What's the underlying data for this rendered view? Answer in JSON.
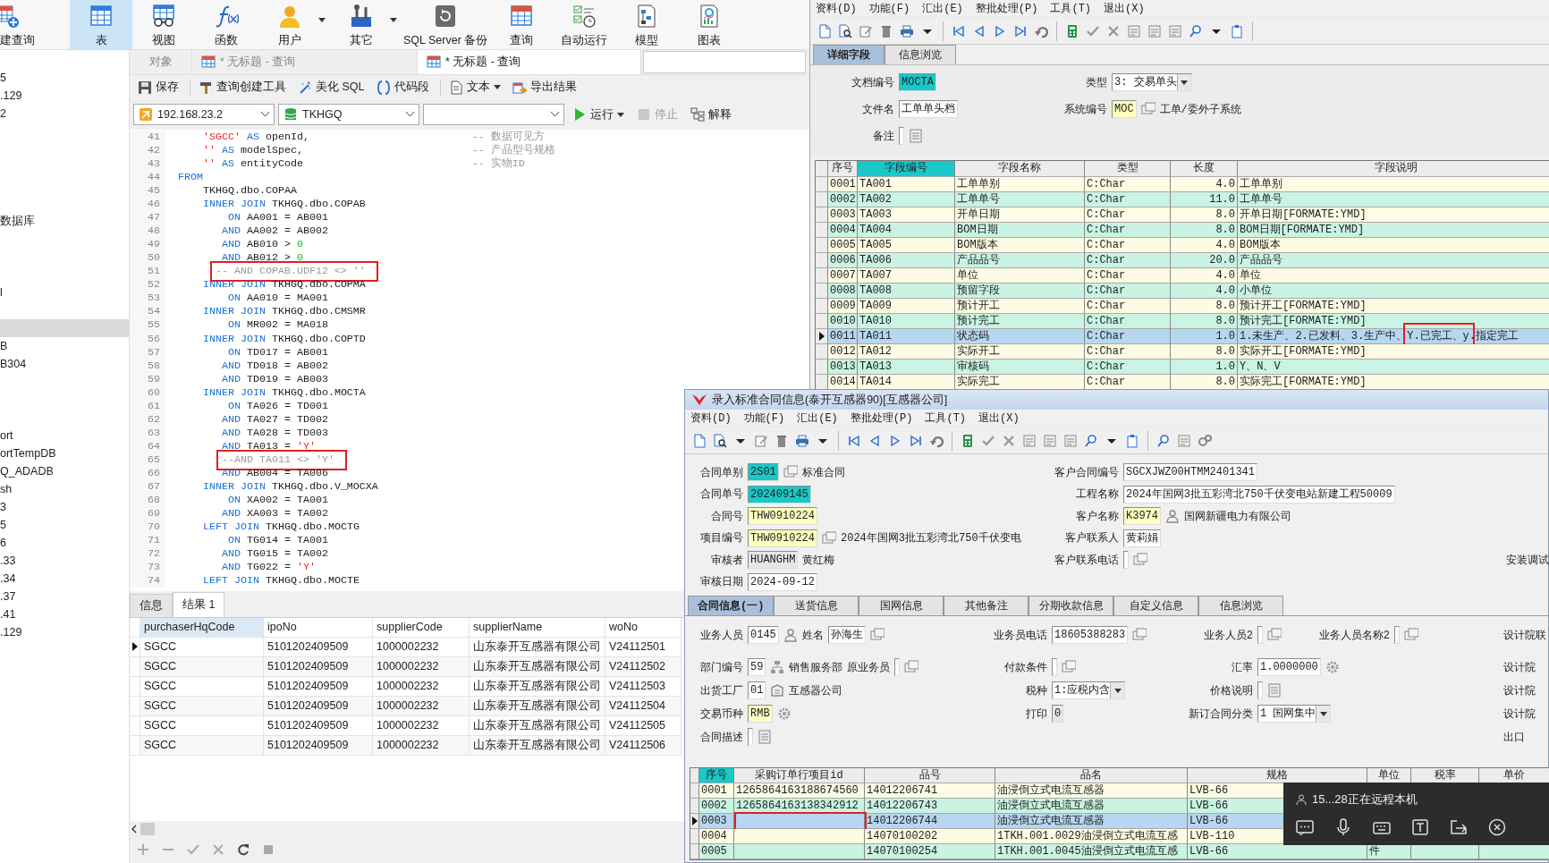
{
  "navicat": {
    "toolbar": [
      {
        "label": "建查询",
        "selected": false,
        "dropdown": false
      },
      {
        "label": "表",
        "selected": true,
        "dropdown": false
      },
      {
        "label": "视图",
        "selected": false,
        "dropdown": false
      },
      {
        "label": "函数",
        "selected": false,
        "dropdown": false
      },
      {
        "label": "用户",
        "selected": false,
        "dropdown": true
      },
      {
        "label": "其它",
        "selected": false,
        "dropdown": true
      },
      {
        "label": "SQL Server 备份",
        "selected": false,
        "dropdown": false
      },
      {
        "label": "查询",
        "selected": false,
        "dropdown": false
      },
      {
        "label": "自动运行",
        "selected": false,
        "dropdown": false
      },
      {
        "label": "模型",
        "selected": false,
        "dropdown": false
      },
      {
        "label": "图表",
        "selected": false,
        "dropdown": false
      }
    ],
    "sidebar": [
      {
        "kind": "item",
        "label": "5",
        "selected": false
      },
      {
        "kind": "item",
        "label": ".129",
        "selected": false
      },
      {
        "kind": "item",
        "label": "2",
        "selected": false
      },
      {
        "kind": "hidden",
        "selected": false
      },
      {
        "kind": "hidden",
        "selected": false
      },
      {
        "kind": "hidden",
        "selected": false
      },
      {
        "kind": "hidden",
        "selected": false
      },
      {
        "kind": "hidden",
        "selected": false
      },
      {
        "kind": "item",
        "label": "数据库",
        "selected": false
      },
      {
        "kind": "hidden",
        "selected": false
      },
      {
        "kind": "hidden",
        "selected": false
      },
      {
        "kind": "hidden",
        "selected": false
      },
      {
        "kind": "item",
        "label": "l",
        "selected": false
      },
      {
        "kind": "hidden",
        "selected": false
      },
      {
        "kind": "hidden",
        "selected": true
      },
      {
        "kind": "item",
        "label": "B",
        "selected": false
      },
      {
        "kind": "item",
        "label": "B304",
        "selected": false
      },
      {
        "kind": "hidden",
        "selected": false
      },
      {
        "kind": "hidden",
        "selected": false
      },
      {
        "kind": "hidden",
        "selected": false
      },
      {
        "kind": "item",
        "label": "ort",
        "selected": false
      },
      {
        "kind": "item",
        "label": "ortTempDB",
        "selected": false
      },
      {
        "kind": "item",
        "label": "Q_ADADB",
        "selected": false
      },
      {
        "kind": "item",
        "label": "sh",
        "selected": false
      },
      {
        "kind": "item",
        "label": "3",
        "selected": false
      },
      {
        "kind": "item",
        "label": "5",
        "selected": false
      },
      {
        "kind": "item",
        "label": "6",
        "selected": false
      },
      {
        "kind": "item",
        "label": ".33",
        "selected": false
      },
      {
        "kind": "item",
        "label": ".34",
        "selected": false
      },
      {
        "kind": "item",
        "label": ".37",
        "selected": false
      },
      {
        "kind": "item",
        "label": ".41",
        "selected": false
      },
      {
        "kind": "item",
        "label": ".129",
        "selected": false
      }
    ],
    "editor_tabs": [
      {
        "label": "对象",
        "selected": false
      },
      {
        "label": "* 无标题 - 查询",
        "selected": false
      },
      {
        "label": "* 无标题 - 查询",
        "selected": true
      }
    ],
    "actions": [
      {
        "label": "保存",
        "dropdown": false
      },
      {
        "label": "查询创建工具",
        "dropdown": false
      },
      {
        "label": "美化 SQL",
        "dropdown": false
      },
      {
        "label": "代码段",
        "dropdown": false
      },
      {
        "label": "文本",
        "dropdown": true
      },
      {
        "label": "导出结果",
        "dropdown": false
      }
    ],
    "connection": "192.168.23.2",
    "database": "TKHGQ",
    "run_controls": [
      {
        "label": "运行",
        "dropdown": true,
        "disabled": false
      },
      {
        "label": "停止",
        "dropdown": false,
        "disabled": true
      },
      {
        "label": "解释",
        "dropdown": false,
        "disabled": false
      }
    ],
    "editor": {
      "lines": [
        {
          "number": "41",
          "code": [
            {
              "kind": "str",
              "text": "      'SGCC'"
            },
            {
              "kind": "kw",
              "text": " AS"
            },
            {
              "kind": "txt",
              "text": " openId,"
            }
          ],
          "comment": "-- 数据可见方",
          "marked": false
        },
        {
          "number": "42",
          "code": [
            {
              "kind": "str",
              "text": "      ''"
            },
            {
              "kind": "kw",
              "text": " AS"
            },
            {
              "kind": "txt",
              "text": " modelSpec,"
            }
          ],
          "comment": "-- 产品型号规格",
          "marked": false
        },
        {
          "number": "43",
          "code": [
            {
              "kind": "str",
              "text": "      ''"
            },
            {
              "kind": "kw",
              "text": " AS"
            },
            {
              "kind": "txt",
              "text": " entityCode"
            }
          ],
          "comment": "-- 实物ID",
          "marked": false
        },
        {
          "number": "44",
          "code": [
            {
              "kind": "kw",
              "text": "  FROM"
            }
          ],
          "marked": false
        },
        {
          "number": "45",
          "code": [
            {
              "kind": "txt",
              "text": "      TKHGQ.dbo.COPAA"
            }
          ],
          "marked": false
        },
        {
          "number": "46",
          "code": [
            {
              "kind": "kw",
              "text": "      INNER JOIN"
            },
            {
              "kind": "txt",
              "text": " TKHGQ.dbo.COPAB"
            }
          ],
          "marked": false
        },
        {
          "number": "47",
          "code": [
            {
              "kind": "kw",
              "text": "          ON"
            },
            {
              "kind": "txt",
              "text": " AA001 = AB001"
            }
          ],
          "marked": false
        },
        {
          "number": "48",
          "code": [
            {
              "kind": "kw",
              "text": "         AND"
            },
            {
              "kind": "txt",
              "text": " AA002 = AB002"
            }
          ],
          "marked": false
        },
        {
          "number": "49",
          "code": [
            {
              "kind": "kw",
              "text": "         AND"
            },
            {
              "kind": "txt",
              "text": " AB010 > "
            },
            {
              "kind": "num",
              "text": "0"
            }
          ],
          "marked": false
        },
        {
          "number": "50",
          "code": [
            {
              "kind": "kw",
              "text": "         AND"
            },
            {
              "kind": "txt",
              "text": " AB012 > "
            },
            {
              "kind": "num",
              "text": "0"
            }
          ],
          "marked": false
        },
        {
          "number": "51",
          "code": [
            {
              "kind": "cmt",
              "text": "        -- AND COPAB.UDF12 <> ''"
            }
          ],
          "marked": true
        },
        {
          "number": "52",
          "code": [
            {
              "kind": "kw",
              "text": "      INNER JOIN"
            },
            {
              "kind": "txt",
              "text": " TKHGQ.dbo.COPMA"
            }
          ],
          "marked": false
        },
        {
          "number": "53",
          "code": [
            {
              "kind": "kw",
              "text": "          ON"
            },
            {
              "kind": "txt",
              "text": " AA010 = MA001"
            }
          ],
          "marked": false
        },
        {
          "number": "54",
          "code": [
            {
              "kind": "kw",
              "text": "      INNER JOIN"
            },
            {
              "kind": "txt",
              "text": " TKHGQ.dbo.CMSMR"
            }
          ],
          "marked": false
        },
        {
          "number": "55",
          "code": [
            {
              "kind": "kw",
              "text": "          ON"
            },
            {
              "kind": "txt",
              "text": " MR002 = MA018"
            }
          ],
          "marked": false
        },
        {
          "number": "56",
          "code": [
            {
              "kind": "kw",
              "text": "      INNER JOIN"
            },
            {
              "kind": "txt",
              "text": " TKHGQ.dbo.COPTD"
            }
          ],
          "marked": false
        },
        {
          "number": "57",
          "code": [
            {
              "kind": "kw",
              "text": "          ON"
            },
            {
              "kind": "txt",
              "text": " TD017 = AB001"
            }
          ],
          "marked": false
        },
        {
          "number": "58",
          "code": [
            {
              "kind": "kw",
              "text": "         AND"
            },
            {
              "kind": "txt",
              "text": " TD018 = AB002"
            }
          ],
          "marked": false
        },
        {
          "number": "59",
          "code": [
            {
              "kind": "kw",
              "text": "         AND"
            },
            {
              "kind": "txt",
              "text": " TD019 = AB003"
            }
          ],
          "marked": false
        },
        {
          "number": "60",
          "code": [
            {
              "kind": "kw",
              "text": "      INNER JOIN"
            },
            {
              "kind": "txt",
              "text": " TKHGQ.dbo.MOCTA"
            }
          ],
          "marked": false
        },
        {
          "number": "61",
          "code": [
            {
              "kind": "kw",
              "text": "          ON"
            },
            {
              "kind": "txt",
              "text": " TA026 = TD001"
            }
          ],
          "marked": false
        },
        {
          "number": "62",
          "code": [
            {
              "kind": "kw",
              "text": "         AND"
            },
            {
              "kind": "txt",
              "text": " TA027 = TD002"
            }
          ],
          "marked": false
        },
        {
          "number": "63",
          "code": [
            {
              "kind": "kw",
              "text": "         AND"
            },
            {
              "kind": "txt",
              "text": " TA028 = TD003"
            }
          ],
          "marked": false
        },
        {
          "number": "64",
          "code": [
            {
              "kind": "kw",
              "text": "         AND"
            },
            {
              "kind": "txt",
              "text": " TA013 = "
            },
            {
              "kind": "str",
              "text": "'Y'"
            }
          ],
          "marked": false
        },
        {
          "number": "65",
          "code": [
            {
              "kind": "cmt",
              "text": "         --AND TA011 <> 'Y'"
            }
          ],
          "marked": true
        },
        {
          "number": "66",
          "code": [
            {
              "kind": "kw",
              "text": "         AND"
            },
            {
              "kind": "txt",
              "text": " AB004 = TA006"
            }
          ],
          "marked": false
        },
        {
          "number": "67",
          "code": [
            {
              "kind": "kw",
              "text": "      INNER JOIN"
            },
            {
              "kind": "txt",
              "text": " TKHGQ.dbo.V_MOCXA"
            }
          ],
          "marked": false
        },
        {
          "number": "68",
          "code": [
            {
              "kind": "kw",
              "text": "          ON"
            },
            {
              "kind": "txt",
              "text": " XA002 = TA001"
            }
          ],
          "marked": false
        },
        {
          "number": "69",
          "code": [
            {
              "kind": "kw",
              "text": "         AND"
            },
            {
              "kind": "txt",
              "text": " XA003 = TA002"
            }
          ],
          "marked": false
        },
        {
          "number": "70",
          "code": [
            {
              "kind": "kw",
              "text": "      LEFT JOIN"
            },
            {
              "kind": "txt",
              "text": " TKHGQ.dbo.MOCTG"
            }
          ],
          "marked": false
        },
        {
          "number": "71",
          "code": [
            {
              "kind": "kw",
              "text": "          ON"
            },
            {
              "kind": "txt",
              "text": " TG014 = TA001"
            }
          ],
          "marked": false
        },
        {
          "number": "72",
          "code": [
            {
              "kind": "kw",
              "text": "         AND"
            },
            {
              "kind": "txt",
              "text": " TG015 = TA002"
            }
          ],
          "marked": false
        },
        {
          "number": "73",
          "code": [
            {
              "kind": "kw",
              "text": "         AND"
            },
            {
              "kind": "txt",
              "text": " TG022 = "
            },
            {
              "kind": "str",
              "text": "'Y'"
            }
          ],
          "marked": false
        },
        {
          "number": "74",
          "code": [
            {
              "kind": "kw",
              "text": "      LEFT JOIN"
            },
            {
              "kind": "txt",
              "text": " TKHGQ.dbo.MOCTE"
            }
          ],
          "marked": false
        }
      ]
    },
    "result_tabs": [
      {
        "label": "信息",
        "selected": false
      },
      {
        "label": "结果 1",
        "selected": true
      }
    ],
    "result": {
      "columns": [
        {
          "label": "purchaserHqCode",
          "selected": true
        },
        {
          "label": "ipoNo",
          "selected": false
        },
        {
          "label": "supplierCode",
          "selected": false
        },
        {
          "label": "supplierName",
          "selected": false
        },
        {
          "label": "woNo",
          "selected": false
        }
      ],
      "rows": [
        {
          "current": true,
          "cells": [
            "SGCC",
            "5101202409509",
            "1000002232",
            "山东泰开互感器有限公司",
            "V24112501"
          ]
        },
        {
          "current": false,
          "cells": [
            "SGCC",
            "5101202409509",
            "1000002232",
            "山东泰开互感器有限公司",
            "V24112502"
          ]
        },
        {
          "current": false,
          "cells": [
            "SGCC",
            "5101202409509",
            "1000002232",
            "山东泰开互感器有限公司",
            "V24112503"
          ]
        },
        {
          "current": false,
          "cells": [
            "SGCC",
            "5101202409509",
            "1000002232",
            "山东泰开互感器有限公司",
            "V24112504"
          ]
        },
        {
          "current": false,
          "cells": [
            "SGCC",
            "5101202409509",
            "1000002232",
            "山东泰开互感器有限公司",
            "V24112505"
          ]
        },
        {
          "current": false,
          "cells": [
            "SGCC",
            "5101202409509",
            "1000002232",
            "山东泰开互感器有限公司",
            "V24112506"
          ]
        }
      ]
    }
  },
  "field_window": {
    "menu": [
      "资料(D)",
      "功能(F)",
      "汇出(E)",
      "整批处理(P)",
      "工具(T)",
      "退出(X)"
    ],
    "tabs": [
      {
        "label": "详细字段",
        "selected": true
      },
      {
        "label": "信息浏览",
        "selected": false
      }
    ],
    "form": [
      [
        {
          "label": "文档编号",
          "value": "MOCTA",
          "kind": "key"
        },
        {
          "label": "类型",
          "value": "3: 交易单头",
          "kind": "select"
        }
      ],
      [
        {
          "label": "文件名",
          "value": "工单单头档",
          "kind": "plain",
          "lookup": false
        },
        {
          "label": "系统编号",
          "value": "MOC",
          "kind": "required",
          "lookup": true,
          "note": "工单/委外子系统"
        }
      ],
      [
        {
          "label": "备注",
          "kind": "plain",
          "lookup": true
        }
      ]
    ],
    "grid": {
      "columns": [
        {
          "label": "序号",
          "selected": false
        },
        {
          "label": "字段编号",
          "selected": true
        },
        {
          "label": "字段名称",
          "selected": false
        },
        {
          "label": "类型",
          "selected": false
        },
        {
          "label": "长度",
          "selected": false
        },
        {
          "label": "字段说明",
          "selected": false
        }
      ],
      "rows": [
        {
          "selected": false,
          "marked": false,
          "cells": [
            "0001",
            "TA001",
            "工单单别",
            "C:Char",
            "4.0",
            "工单单别"
          ]
        },
        {
          "selected": false,
          "marked": false,
          "cells": [
            "0002",
            "TA002",
            "工单单号",
            "C:Char",
            "11.0",
            "工单单号"
          ]
        },
        {
          "selected": false,
          "marked": false,
          "cells": [
            "0003",
            "TA003",
            "开单日期",
            "C:Char",
            "8.0",
            "开单日期[FORMATE:YMD]"
          ]
        },
        {
          "selected": false,
          "marked": false,
          "cells": [
            "0004",
            "TA004",
            "BOM日期",
            "C:Char",
            "8.0",
            "BOM日期[FORMATE:YMD]"
          ]
        },
        {
          "selected": false,
          "marked": false,
          "cells": [
            "0005",
            "TA005",
            "BOM版本",
            "C:Char",
            "4.0",
            "BOM版本"
          ]
        },
        {
          "selected": false,
          "marked": false,
          "cells": [
            "0006",
            "TA006",
            "产品品号",
            "C:Char",
            "20.0",
            "产品品号"
          ]
        },
        {
          "selected": false,
          "marked": false,
          "cells": [
            "0007",
            "TA007",
            "单位",
            "C:Char",
            "4.0",
            "单位"
          ]
        },
        {
          "selected": false,
          "marked": false,
          "cells": [
            "0008",
            "TA008",
            "预留字段",
            "C:Char",
            "4.0",
            "小单位"
          ]
        },
        {
          "selected": false,
          "marked": false,
          "cells": [
            "0009",
            "TA009",
            "预计开工",
            "C:Char",
            "8.0",
            "预计开工[FORMATE:YMD]"
          ]
        },
        {
          "selected": false,
          "marked": false,
          "cells": [
            "0010",
            "TA010",
            "预计完工",
            "C:Char",
            "8.0",
            "预计完工[FORMATE:YMD]"
          ]
        },
        {
          "selected": true,
          "marked": true,
          "cells": [
            "0011",
            "TA011",
            "状态码",
            "C:Char",
            "1.0",
            "1.未生产、2.已发料、3.生产中、Y.已完工、y.指定完工"
          ]
        },
        {
          "selected": false,
          "marked": false,
          "cells": [
            "0012",
            "TA012",
            "实际开工",
            "C:Char",
            "8.0",
            "实际开工[FORMATE:YMD]"
          ]
        },
        {
          "selected": false,
          "marked": false,
          "cells": [
            "0013",
            "TA013",
            "审核码",
            "C:Char",
            "1.0",
            "Y、N、V"
          ]
        },
        {
          "selected": false,
          "marked": false,
          "cells": [
            "0014",
            "TA014",
            "实际完工",
            "C:Char",
            "8.0",
            "实际完工[FORMATE:YMD]"
          ]
        }
      ]
    }
  },
  "contract_window": {
    "title": "录入标准合同信息(泰开互感器90)[互感器公司]",
    "menu": [
      "资料(D)",
      "功能(F)",
      "汇出(E)",
      "整批处理(P)",
      "工具(T)",
      "退出(X)"
    ],
    "header": [
      {
        "left": {
          "label": "合同单别",
          "value": "2S01",
          "kind": "key",
          "lookup": true,
          "note": "标准合同"
        },
        "right": {
          "label": "客户合同编号",
          "value": "SGCXJWZ00HTMM2401341",
          "kind": "plain",
          "lookup": false
        }
      },
      {
        "left": {
          "label": "合同单号",
          "value": "202409145",
          "kind": "key",
          "lookup": false
        },
        "right": {
          "label": "工程名称",
          "value": "2024年国网3批五彩湾北750千伏变电站新建工程50009",
          "kind": "plain",
          "lookup": false
        }
      },
      {
        "left": {
          "label": "合同号",
          "value": "THW0910224",
          "kind": "required",
          "lookup": false
        },
        "right": {
          "label": "客户名称",
          "value": "K3974",
          "kind": "required",
          "lookup": true,
          "note": "国网新疆电力有限公司"
        }
      },
      {
        "left": {
          "label": "项目编号",
          "value": "THW0910224",
          "kind": "required",
          "lookup": true,
          "note": "2024年国网3批五彩湾北750千伏变电"
        },
        "right": {
          "label": "客户联系人",
          "value": "黄莉娟",
          "kind": "plain",
          "lookup": false
        }
      },
      {
        "left": {
          "label": "审核者",
          "value": "HUANGHM",
          "kind": "readonly",
          "lookup": false,
          "note": "黄红梅"
        },
        "right": {
          "label": "客户联系电话",
          "kind": "plain",
          "lookup": true
        },
        "edge": {
          "label": "安装调试"
        }
      },
      {
        "left": {
          "label": "审核日期",
          "value": "2024-09-12",
          "kind": "plain",
          "lookup": false
        }
      }
    ],
    "tabs": [
      {
        "label": "合同信息(一)",
        "selected": true
      },
      {
        "label": "送货信息",
        "selected": false
      },
      {
        "label": "国网信息",
        "selected": false
      },
      {
        "label": "其他备注",
        "selected": false
      },
      {
        "label": "分期收款信息",
        "selected": false
      },
      {
        "label": "自定义信息",
        "selected": false
      },
      {
        "label": "信息浏览",
        "selected": false
      }
    ],
    "detail": [
      {
        "column_1": {
          "label": "业务人员",
          "value": "0145",
          "kind": "plain",
          "lookup": true
        },
        "column_1b": {
          "label": "姓名",
          "value": "孙海生",
          "kind": "plain",
          "lookup": true
        },
        "column_2": {
          "label": "业务员电话",
          "value": "18605388283",
          "kind": "plain",
          "lookup": true
        },
        "column_3": {
          "label": "业务人员2",
          "kind": "plain",
          "lookup": true
        },
        "column_4": {
          "label": "业务人员名称2",
          "kind": "plain",
          "lookup": true
        },
        "edge": {
          "label": "设计院联"
        }
      },
      {
        "column_1": {
          "label": "部门编号",
          "value": "59",
          "kind": "plain",
          "lookup": true,
          "note": "销售服务部"
        },
        "column_1b": {
          "label": "原业务员",
          "kind": "plain",
          "lookup": true
        },
        "column_2": {
          "label": "付款条件",
          "kind": "plain",
          "lookup": true
        },
        "column_3": {
          "label": "汇率",
          "value": "1.0000000",
          "kind": "number",
          "lookup": true
        },
        "edge": {
          "label": "设计院"
        }
      },
      {
        "column_1": {
          "label": "出货工厂",
          "value": "01",
          "kind": "plain",
          "lookup": true,
          "note": "互感器公司"
        },
        "column_2": {
          "label": "税种",
          "value": "1:应税内含",
          "kind": "select",
          "lookup": false
        },
        "column_3": {
          "label": "价格说明",
          "kind": "plain",
          "lookup": true
        },
        "edge": {
          "label": "设计院"
        }
      },
      {
        "column_1": {
          "label": "交易币种",
          "value": "RMB",
          "kind": "required",
          "lookup": true
        },
        "column_2": {
          "label": "打印",
          "value": "0",
          "kind": "readonly",
          "lookup": false
        },
        "column_3": {
          "label": "新订合同分类",
          "value": "1 国网集中",
          "kind": "select",
          "lookup": false
        },
        "edge": {
          "label": "设计院"
        }
      },
      {
        "column_1": {
          "label": "合同描述",
          "kind": "plain",
          "lookup": true
        },
        "edge": {
          "label": "出口"
        }
      }
    ],
    "grid": {
      "columns": [
        {
          "label": "序号",
          "selected": true
        },
        {
          "label": "采购订单行项目id",
          "selected": false
        },
        {
          "label": "品号",
          "selected": false
        },
        {
          "label": "品名",
          "selected": false
        },
        {
          "label": "规格",
          "selected": false
        },
        {
          "label": "单位",
          "selected": false
        },
        {
          "label": "税率",
          "selected": false
        },
        {
          "label": "单价",
          "selected": false
        }
      ],
      "rows": [
        {
          "selected": false,
          "marked": false,
          "number": "0001",
          "order_line_id": "1265864163188674560",
          "item_no": "14012206741",
          "item_name": "油浸倒立式电流互感器",
          "spec": "LVB-66"
        },
        {
          "selected": false,
          "marked": false,
          "number": "0002",
          "order_line_id": "1265864163138342912",
          "item_no": "14012206743",
          "item_name": "油浸倒立式电流互感器",
          "spec": "LVB-66"
        },
        {
          "selected": true,
          "marked": true,
          "number": "0003",
          "item_no": "14012206744",
          "item_name": "油浸倒立式电流互感器",
          "spec": "LVB-66"
        },
        {
          "selected": false,
          "marked": false,
          "number": "0004",
          "item_no": "14070100202",
          "item_name": "1TKH.001.0029油浸倒立式电流互感",
          "spec": "LVB-110"
        },
        {
          "selected": false,
          "marked": false,
          "number": "0005",
          "item_no": "14070100254",
          "item_name": "1TKH.001.0045油浸倒立式电流互感",
          "spec": "LVB-66",
          "unit": "件"
        }
      ]
    }
  },
  "remote_banner": {
    "text": "15...28正在远程本机"
  }
}
